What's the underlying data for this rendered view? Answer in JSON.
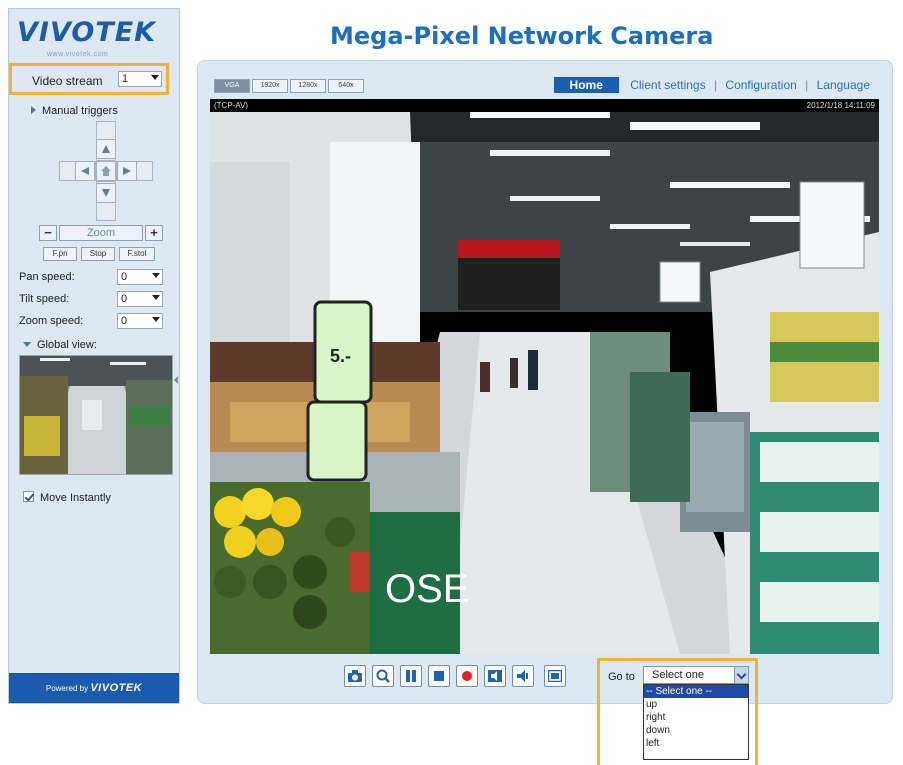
{
  "header": {
    "brand": "VIVOTEK",
    "brand_sub": "www.vivotek.com",
    "title": "Mega-Pixel Network Camera"
  },
  "sidebar": {
    "video_stream_label": "Video stream",
    "video_stream_value": "1",
    "manual_triggers": "Manual triggers",
    "zoom_label": "Zoom",
    "zoom_minus": "−",
    "zoom_plus": "+",
    "small_buttons": [
      "F.pn",
      "Stop",
      "F.stol"
    ],
    "pan_speed_label": "Pan speed:",
    "pan_speed_value": "0",
    "tilt_speed_label": "Tilt speed:",
    "tilt_speed_value": "0",
    "zoom_speed_label": "Zoom speed:",
    "zoom_speed_value": "0",
    "global_view_label": "Global view:",
    "move_instantly_label": "Move Instantly",
    "move_instantly_checked": true,
    "powered_by": "Powered by",
    "powered_brand": "VIVOTEK"
  },
  "main": {
    "size_buttons": [
      "VGA",
      "1920x",
      "1280x",
      "640x"
    ],
    "nav": {
      "home": "Home",
      "client_settings": "Client settings",
      "configuration": "Configuration",
      "language": "Language"
    },
    "video": {
      "mode": "(TCP-AV)",
      "timestamp": "2012/1/18 14:11:09"
    },
    "controls": [
      "snapshot-icon",
      "digital-zoom-icon",
      "pause-icon",
      "stop-icon",
      "record-icon",
      "volume-icon",
      "mute-icon",
      "fullscreen-icon"
    ],
    "goto_label": "Go to",
    "goto_select_value": "Select one",
    "goto_options": [
      "-- Select one --",
      "up",
      "right",
      "down",
      "left"
    ]
  },
  "colors": {
    "brand_blue": "#1d6ec1",
    "highlight": "#f2b233",
    "panel_bg": "#dce9f3",
    "record_red": "#e02020"
  }
}
